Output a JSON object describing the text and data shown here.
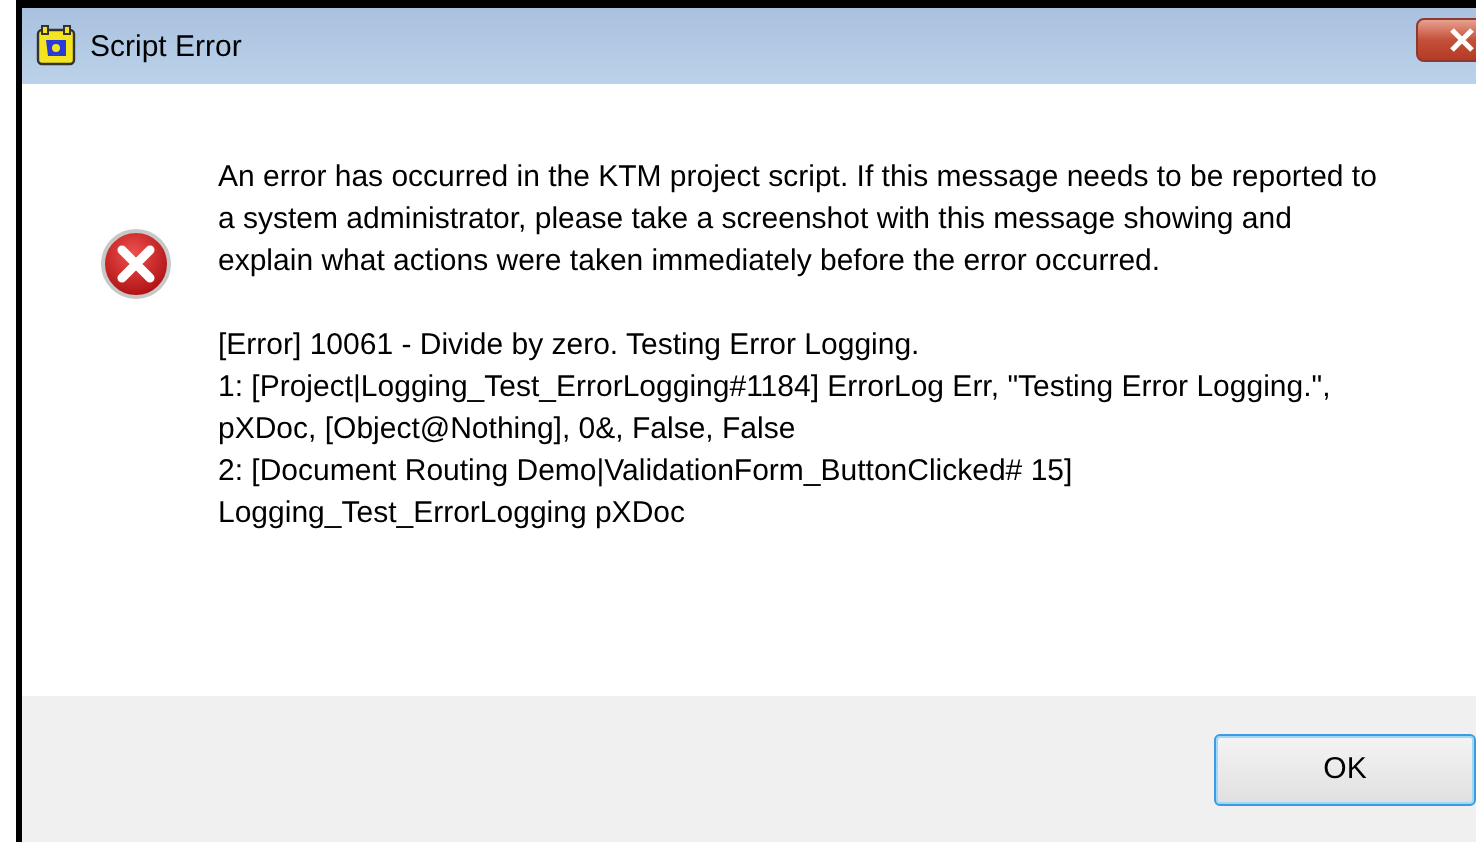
{
  "window": {
    "title": "Script Error"
  },
  "message": {
    "kind": "error",
    "paragraphs": [
      "An error has occurred in the KTM project script.  If this message needs to be reported to a system administrator, please take a screenshot with this message showing and explain what actions were taken immediately before the error occurred.",
      "[Error] 10061 - Divide by zero.  Testing Error Logging.\n1: [Project|Logging_Test_ErrorLogging#1184] ErrorLog Err, \"Testing Error Logging.\", pXDoc, [Object@Nothing], 0&, False, False\n2: [Document Routing Demo|ValidationForm_ButtonClicked# 15] Logging_Test_ErrorLogging pXDoc"
    ]
  },
  "buttons": [
    {
      "label": "OK",
      "selected": true
    }
  ]
}
